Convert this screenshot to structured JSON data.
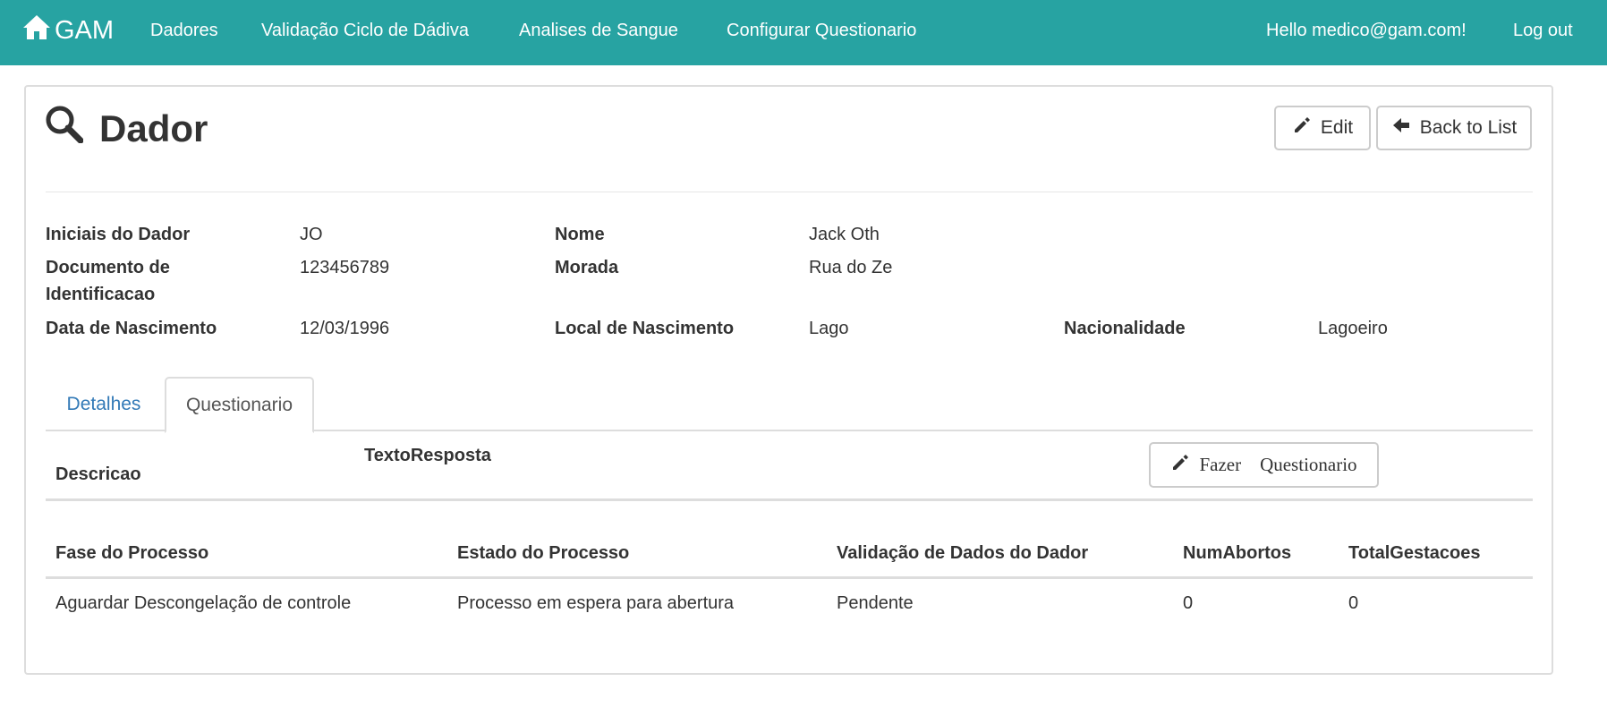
{
  "nav": {
    "brand": "GAM",
    "links": [
      "Dadores",
      "Validação Ciclo de Dádiva",
      "Analises de Sangue",
      "Configurar Questionario"
    ],
    "greeting": "Hello medico@gam.com!",
    "logout": "Log out"
  },
  "page": {
    "title": "Dador",
    "edit_label": "Edit",
    "back_label": "Back to List"
  },
  "details": {
    "iniciais": {
      "label": "Iniciais do Dador",
      "value": "JO"
    },
    "documento": {
      "label": "Documento de Identificacao",
      "value": "123456789"
    },
    "nascimento": {
      "label": "Data de Nascimento",
      "value": "12/03/1996"
    },
    "nome": {
      "label": "Nome",
      "value": "Jack Oth"
    },
    "morada": {
      "label": "Morada",
      "value": "Rua do Ze"
    },
    "local": {
      "label": "Local de Nascimento",
      "value": "Lago"
    },
    "nacionalidade": {
      "label": "Nacionalidade",
      "value": "Lagoeiro"
    }
  },
  "tabs": [
    "Detalhes",
    "Questionario"
  ],
  "questionario": {
    "col_descricao": "Descricao",
    "col_texto": "TextoResposta",
    "button": "Fazer    Questionario"
  },
  "processo": {
    "headers": [
      "Fase do Processo",
      "Estado do Processo",
      "Validação de Dados do Dador",
      "NumAbortos",
      "TotalGestacoes"
    ],
    "row": [
      "Aguardar Descongelação de controle",
      "Processo em espera para abertura",
      "Pendente",
      "0",
      "0"
    ]
  },
  "colors": {
    "navbar": "#27a3a2",
    "link": "#337ab7"
  }
}
